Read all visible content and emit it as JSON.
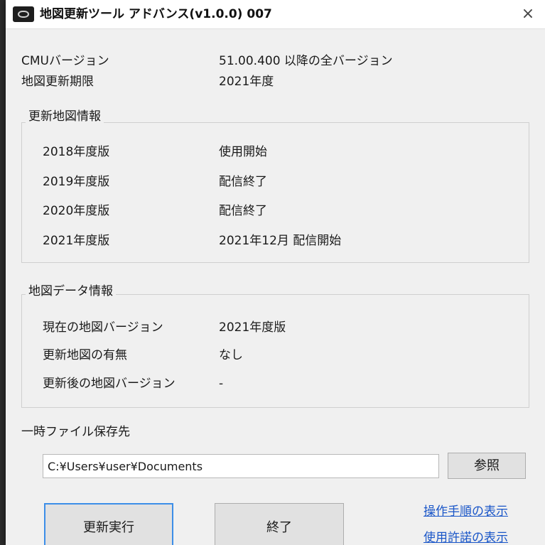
{
  "window": {
    "title": "地図更新ツール アドバンス(v1.0.0) 007",
    "close_label": "×"
  },
  "info": {
    "cmu_label": "CMUバージョン",
    "cmu_value": "51.00.400 以降の全バージョン",
    "deadline_label": "地図更新期限",
    "deadline_value": "2021年度"
  },
  "update_map_info": {
    "title": "更新地図情報",
    "rows": [
      {
        "label": "2018年度版",
        "value": "使用開始"
      },
      {
        "label": "2019年度版",
        "value": "配信終了"
      },
      {
        "label": "2020年度版",
        "value": "配信終了"
      },
      {
        "label": "2021年度版",
        "value": "2021年12月 配信開始"
      }
    ]
  },
  "map_data_info": {
    "title": "地図データ情報",
    "rows": [
      {
        "label": "現在の地図バージョン",
        "value": "2021年度版"
      },
      {
        "label": "更新地図の有無",
        "value": "なし"
      },
      {
        "label": "更新後の地図バージョン",
        "value": "-"
      }
    ]
  },
  "temp_folder": {
    "label": "一時ファイル保存先",
    "path": "C:¥Users¥user¥Documents",
    "browse_label": "参照"
  },
  "actions": {
    "execute_label": "更新実行",
    "exit_label": "終了",
    "show_procedure_link": "操作手順の表示",
    "show_license_link": "使用許諾の表示"
  },
  "colors": {
    "window_bg": "#f0f0f0",
    "link": "#1a56c8",
    "focus_border": "#3c8ee8"
  }
}
